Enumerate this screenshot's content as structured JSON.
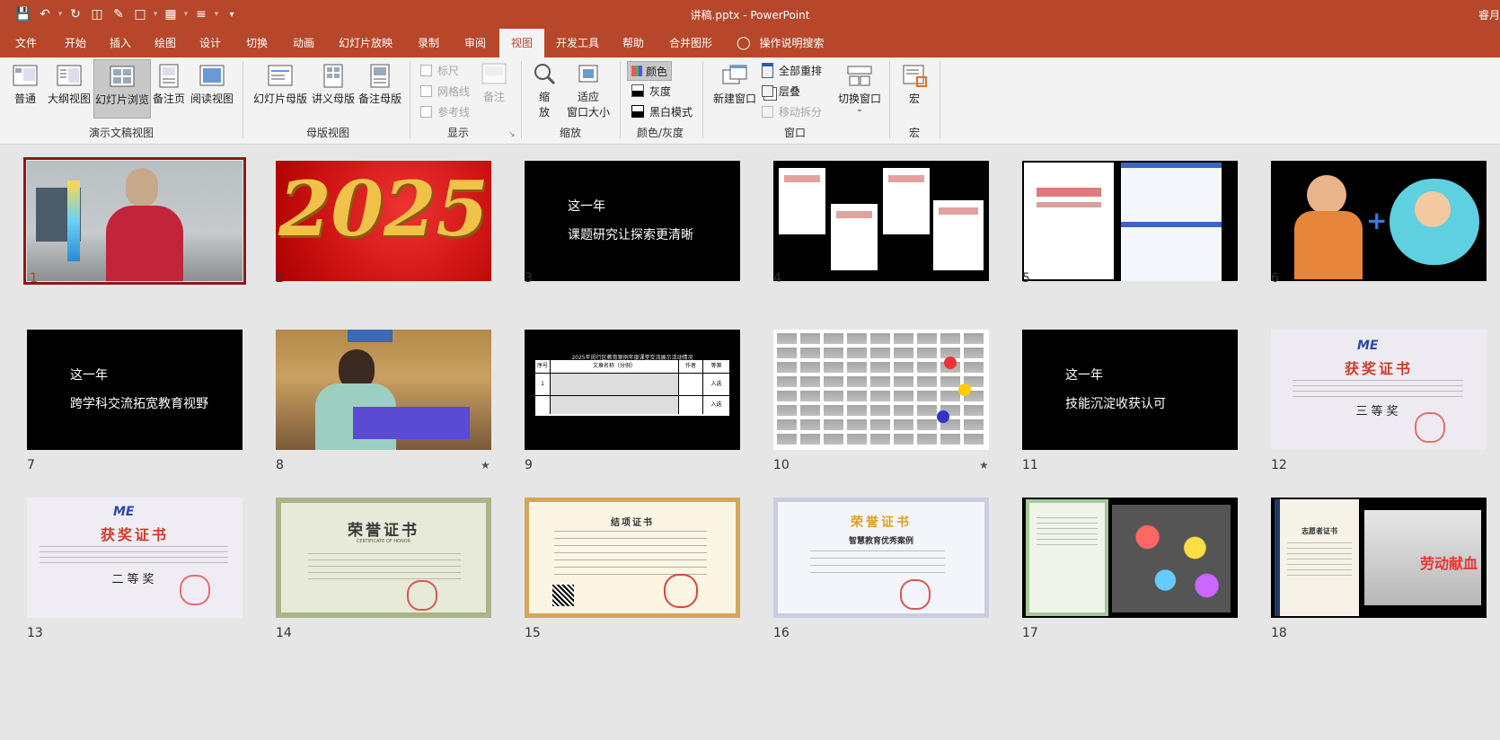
{
  "window": {
    "title": "讲稿.pptx  -  PowerPoint",
    "user": "睿月"
  },
  "quick_access": [
    "save-icon",
    "undo-icon",
    "redo-icon",
    "present-icon",
    "draw-icon",
    "select-icon",
    "shapes-icon",
    "align-icon",
    "customize-icon"
  ],
  "tabs": [
    "文件",
    "开始",
    "插入",
    "绘图",
    "设计",
    "切换",
    "动画",
    "幻灯片放映",
    "录制",
    "审阅",
    "视图",
    "开发工具",
    "帮助",
    "合并图形"
  ],
  "active_tab": "视图",
  "tell_me": "操作说明搜索",
  "ribbon": {
    "presentation_views": {
      "label": "演示文稿视图",
      "buttons": [
        "普通",
        "大纲视图",
        "幻灯片浏览",
        "备注页",
        "阅读视图"
      ],
      "selected": "幻灯片浏览"
    },
    "master_views": {
      "label": "母版视图",
      "buttons": [
        "幻灯片母版",
        "讲义母版",
        "备注母版"
      ]
    },
    "show": {
      "label": "显示",
      "checks": [
        "标尺",
        "网格线",
        "参考线"
      ],
      "notes": "备注"
    },
    "zoom": {
      "label": "缩放",
      "zoom_btn_line1": "缩",
      "zoom_btn_line2": "放",
      "fit_line1": "适应",
      "fit_line2": "窗口大小"
    },
    "color": {
      "label": "颜色/灰度",
      "items": [
        "颜色",
        "灰度",
        "黑白模式"
      ]
    },
    "window": {
      "label": "窗口",
      "new_window": "新建窗口",
      "arrange_all": "全部重排",
      "cascade": "层叠",
      "move_split": "移动拆分",
      "switch": "切换窗口"
    },
    "macros": {
      "label": "宏",
      "button": "宏"
    }
  },
  "slides": [
    {
      "n": "1",
      "kind": "photo-person-red"
    },
    {
      "n": "2",
      "kind": "2025",
      "text": "2025"
    },
    {
      "n": "3",
      "kind": "text",
      "lines": [
        "这一年",
        "课题研究让探索更清晰"
      ]
    },
    {
      "n": "4",
      "kind": "certs-4"
    },
    {
      "n": "5",
      "kind": "cert-doc"
    },
    {
      "n": "6",
      "kind": "cartoon"
    },
    {
      "n": "7",
      "kind": "text",
      "lines": [
        "这一年",
        "跨学科交流拓宽教育视野"
      ]
    },
    {
      "n": "8",
      "kind": "photo-speaker",
      "star": true
    },
    {
      "n": "9",
      "kind": "table",
      "caption": "2025年闵行区教育案例年度课堂交流展示活动情况",
      "cols": [
        "序号",
        "文章名称（分例）",
        "作者",
        "等第"
      ],
      "cells": [
        "1",
        "入选",
        "入选"
      ]
    },
    {
      "n": "10",
      "kind": "grid",
      "star": true
    },
    {
      "n": "11",
      "kind": "text",
      "lines": [
        "这一年",
        "技能沉淀收获认可"
      ]
    },
    {
      "n": "12",
      "kind": "award",
      "title": "获奖证书",
      "level": "三等奖"
    },
    {
      "n": "13",
      "kind": "award",
      "title": "获奖证书",
      "level": "二等奖"
    },
    {
      "n": "14",
      "kind": "honor",
      "title": "荣誉证书",
      "sub": "CERTIFICATE OF HONOR"
    },
    {
      "n": "15",
      "kind": "project",
      "title": "结项证书"
    },
    {
      "n": "16",
      "kind": "honor2",
      "title": "荣誉证书",
      "sub": "智慧教育优秀案例"
    },
    {
      "n": "17",
      "kind": "green-cert-photo"
    },
    {
      "n": "18",
      "kind": "volunteer",
      "title": "志愿者证书",
      "badge": "劳动献血"
    }
  ],
  "colors": {
    "accent": "#b7472a",
    "ribbon_bg": "#f3f3f3",
    "sorter_bg": "#e6e6e6",
    "selected_outline": "#8b1a1a"
  }
}
